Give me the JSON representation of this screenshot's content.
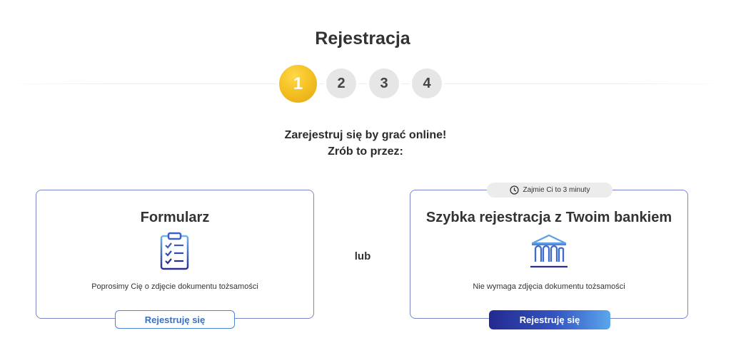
{
  "page": {
    "title": "Rejestracja"
  },
  "steps": [
    {
      "label": "1",
      "active": true
    },
    {
      "label": "2",
      "active": false
    },
    {
      "label": "3",
      "active": false
    },
    {
      "label": "4",
      "active": false
    }
  ],
  "intro": {
    "line1": "Zarejestruj się by grać online!",
    "line2": "Zrób to przez:"
  },
  "option_form": {
    "title": "Formularz",
    "icon": "clipboard-checklist-icon",
    "description": "Poprosimy Cię o zdjęcie dokumentu tożsamości",
    "button_label": "Rejestruję się"
  },
  "separator": {
    "label": "lub"
  },
  "option_bank": {
    "badge_icon": "clock-icon",
    "badge_text": "Zajmie Ci to 3 minuty",
    "title": "Szybka rejestracja z Twoim bankiem",
    "icon": "bank-icon",
    "description": "Nie wymaga zdjęcia dokumentu tożsamości",
    "button_label": "Rejestruję się"
  },
  "colors": {
    "accent_gold": "#f5c224",
    "accent_blue": "#3455c2",
    "card_border": "#7b84c9",
    "step_inactive": "#e6e6e6"
  }
}
